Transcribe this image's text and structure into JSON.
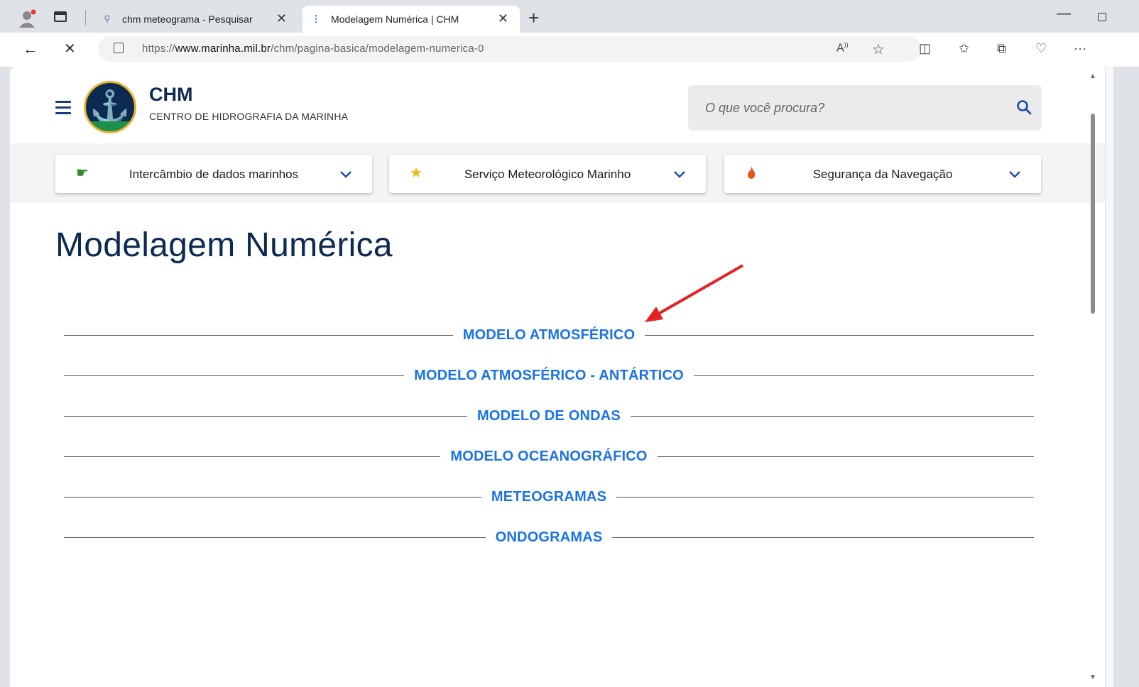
{
  "browser": {
    "tabs": [
      {
        "title": "chm meteograma - Pesquisar",
        "icon": "search-icon"
      },
      {
        "title": "Modelagem Numérica | CHM",
        "icon": "loading-icon"
      }
    ],
    "url_prefix": "https://",
    "url_domain": "www.marinha.mil.br",
    "url_path": "/chm/pagina-basica/modelagem-numerica-0",
    "colors": {
      "chrome": "#dfe3e8",
      "active_tab": "#ffffff"
    }
  },
  "site": {
    "title": "CHM",
    "subtitle": "CENTRO DE HIDROGRAFIA DA MARINHA",
    "search_placeholder": "O que você procura?",
    "menu": [
      {
        "label": "Intercâmbio de dados marinhos",
        "icon": "pointing-hand-icon",
        "color": "#2e8b2e"
      },
      {
        "label": "Serviço Meteorológico Marinho",
        "icon": "star-icon",
        "color": "#f2b707"
      },
      {
        "label": "Segurança da Navegação",
        "icon": "flame-icon",
        "color": "#e8541e"
      }
    ]
  },
  "main": {
    "title": "Modelagem Numérica",
    "links": [
      "MODELO ATMOSFÉRICO",
      "MODELO ATMOSFÉRICO - ANTÁRTICO",
      "MODELO DE ONDAS",
      "MODELO OCEANOGRÁFICO",
      "METEOGRAMAS",
      "ONDOGRAMAS"
    ],
    "link_color": "#1a73e8",
    "annotation_arrow_color": "#e52222"
  }
}
